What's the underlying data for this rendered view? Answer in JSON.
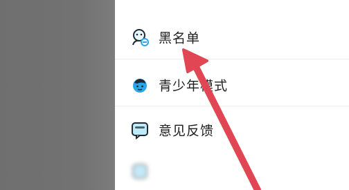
{
  "menu": {
    "items": [
      {
        "label": "黑名单",
        "icon": "blacklist-user-icon"
      },
      {
        "label": "青少年模式",
        "icon": "youth-mode-icon"
      },
      {
        "label": "意见反馈",
        "icon": "feedback-icon"
      },
      {
        "label": "",
        "icon": "settings-icon"
      }
    ]
  },
  "colors": {
    "accent_blue": "#2aa7e8",
    "arrow_red": "#e14654",
    "overlay_gray": "#727272"
  }
}
